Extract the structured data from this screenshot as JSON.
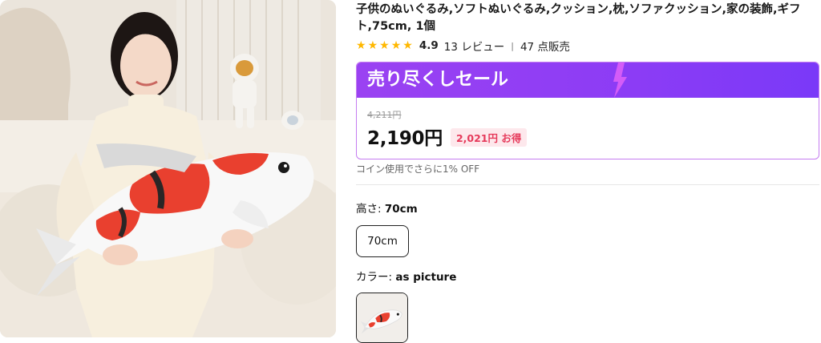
{
  "product": {
    "title": "子供のぬいぐるみ,ソフトぬいぐるみ,クッション,枕,ソファクッション,家の装飾,ギフト,75cm, 1個",
    "image_alt": "product photo: woman holding koi fish plush"
  },
  "rating": {
    "stars": 5,
    "value": "4.9",
    "reviews": "13 レビュー",
    "separator": "|",
    "sold": "47 点販売"
  },
  "sale": {
    "banner": "売り尽くしセール",
    "original_price": "4,211円",
    "price": "2,190円",
    "saving": "2,021円 お得",
    "banner_color": "#8c3cf5",
    "saving_color": "#e63a5b"
  },
  "coin_note": "コイン使用でさらに1% OFF",
  "options": {
    "height_label": "高さ:",
    "height_value": "70cm",
    "height_choices": [
      "70cm"
    ],
    "color_label": "カラー:",
    "color_value": "as picture"
  }
}
